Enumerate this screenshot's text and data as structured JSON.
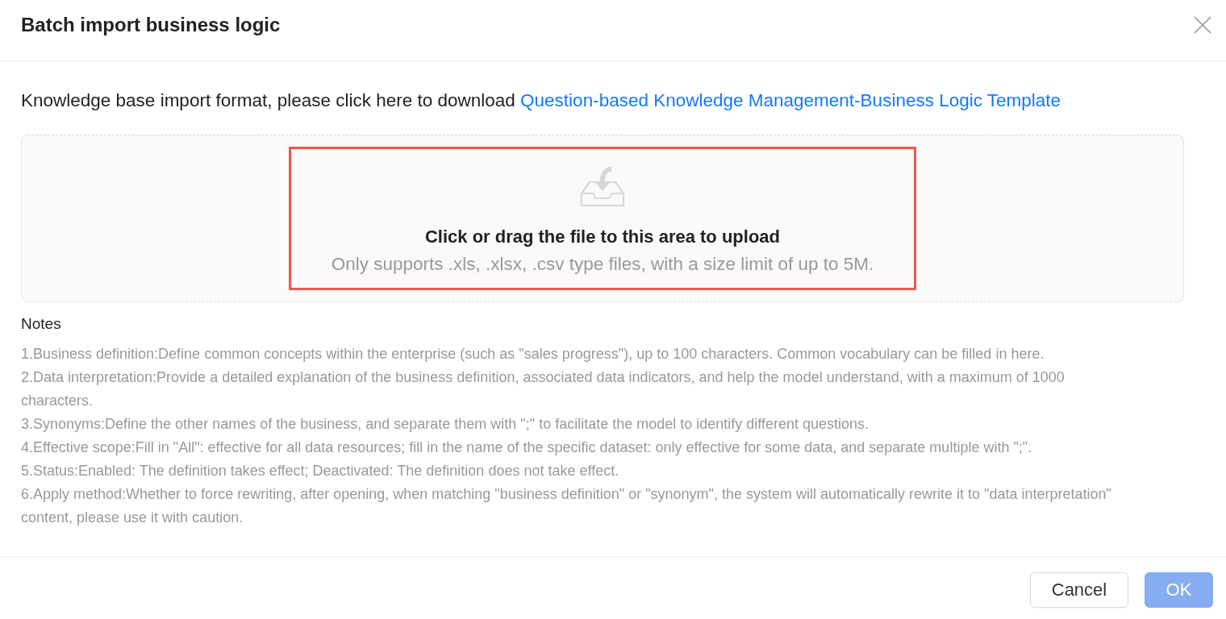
{
  "dialog": {
    "title": "Batch import business logic"
  },
  "intro": {
    "text": "Knowledge base import format, please click here to download ",
    "link": "Question-based Knowledge Management-Business Logic Template"
  },
  "upload": {
    "title": "Click or drag the file to this area to upload",
    "hint": "Only supports .xls, .xlsx, .csv type files, with a size limit of up to 5M.",
    "highlighted": true
  },
  "notes": {
    "heading": "Notes",
    "items": [
      "1.Business definition:Define common concepts within the enterprise (such as \"sales progress\"), up to 100 characters. Common vocabulary can be filled in here.",
      "2.Data interpretation:Provide a detailed explanation of the business definition, associated data indicators, and help the model understand, with a maximum of 1000 characters.",
      "3.Synonyms:Define the other names of the business, and separate them with \";\" to facilitate the model to identify different questions.",
      "4.Effective scope:Fill in \"All\": effective for all data resources; fill in the name of the specific dataset: only effective for some data, and separate multiple with \";\".",
      "5.Status:Enabled: The definition takes effect; Deactivated: The definition does not take effect.",
      "6.Apply method:Whether to force rewriting, after opening, when matching \"business definition\" or \"synonym\", the system will automatically rewrite it to \"data interpretation\" content, please use it with caution."
    ]
  },
  "footer": {
    "buttons": [
      {
        "label": "Cancel",
        "kind": "default",
        "disabled": false
      },
      {
        "label": "OK",
        "kind": "primary",
        "disabled": true
      }
    ]
  }
}
